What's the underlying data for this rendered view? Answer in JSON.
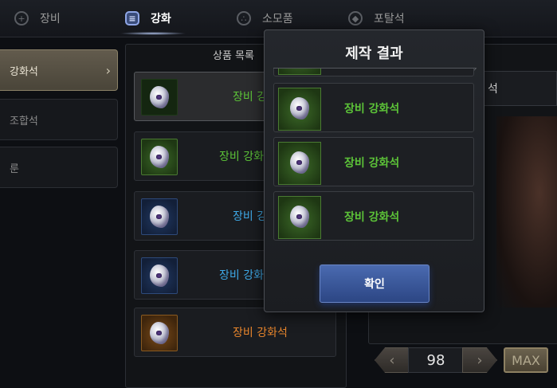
{
  "tabs": [
    {
      "label": "장비",
      "icon": "plus-circle-icon"
    },
    {
      "label": "강화",
      "icon": "list-icon"
    },
    {
      "label": "소모품",
      "icon": "dots-icon"
    },
    {
      "label": "포탈석",
      "icon": "gem-icon"
    }
  ],
  "active_tab": "강화",
  "sidebar": {
    "items": [
      {
        "label": "강화석",
        "active": true
      },
      {
        "label": "조합석",
        "active": false
      },
      {
        "label": "룬",
        "active": false
      }
    ]
  },
  "product_list": {
    "title": "상품 목록",
    "items": [
      {
        "name": "장비 강",
        "grade": "green"
      },
      {
        "name": "장비 강화",
        "grade": "green"
      },
      {
        "name": "장비 강",
        "grade": "blue"
      },
      {
        "name": "장비 강화",
        "grade": "blue"
      },
      {
        "name": "장비 강화석",
        "grade": "orange"
      }
    ]
  },
  "detail_panel": {
    "name_partial": "석"
  },
  "quantity": {
    "value": "98",
    "max_label": "MAX"
  },
  "result_modal": {
    "title": "제작 결과",
    "items": [
      {
        "name": "장비 강화석",
        "grade": "green"
      },
      {
        "name": "장비 강화석",
        "grade": "green"
      },
      {
        "name": "장비 강화석",
        "grade": "green"
      }
    ],
    "confirm_label": "확인"
  },
  "colors": {
    "grade_green": "#5cc338",
    "grade_blue": "#3ea8e6",
    "grade_orange": "#e9862c",
    "confirm_button": "#3a58a0"
  }
}
